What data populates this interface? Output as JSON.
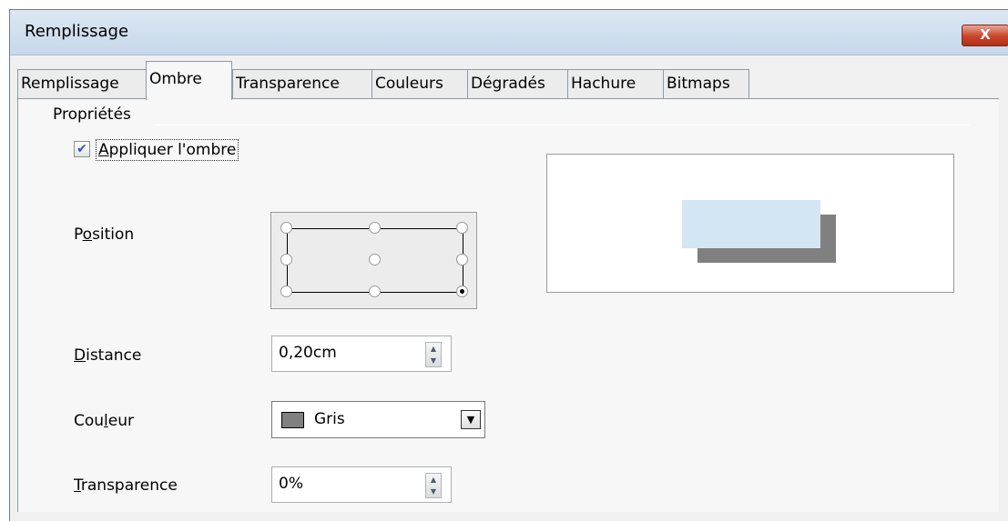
{
  "window": {
    "title": "Remplissage",
    "close_label": "X"
  },
  "tabs": [
    {
      "label": "Remplissage"
    },
    {
      "label": "Ombre"
    },
    {
      "label": "Transparence"
    },
    {
      "label": "Couleurs"
    },
    {
      "label": "Dégradés"
    },
    {
      "label": "Hachure"
    },
    {
      "label": "Bitmaps"
    }
  ],
  "active_tab": "Ombre",
  "properties": {
    "section_label": "Propriétés",
    "apply_shadow": {
      "label_underlined": "A",
      "label_rest": "ppliquer l'ombre",
      "checked": true
    },
    "position": {
      "label_pre": "P",
      "label_underlined": "o",
      "label_post": "sition",
      "selected": "bottom-right"
    },
    "distance": {
      "label_underlined": "D",
      "label_rest": "istance",
      "value": "0,20cm"
    },
    "color": {
      "label_pre": "Cou",
      "label_underlined": "l",
      "label_post": "eur",
      "value": "Gris",
      "swatch": "#808080"
    },
    "transparency": {
      "label_underlined": "T",
      "label_rest": "ransparence",
      "value": "0%"
    }
  },
  "colors": {
    "preview_fill": "#d2e6f4",
    "shadow": "#808080",
    "close_button": "#c8442b"
  }
}
